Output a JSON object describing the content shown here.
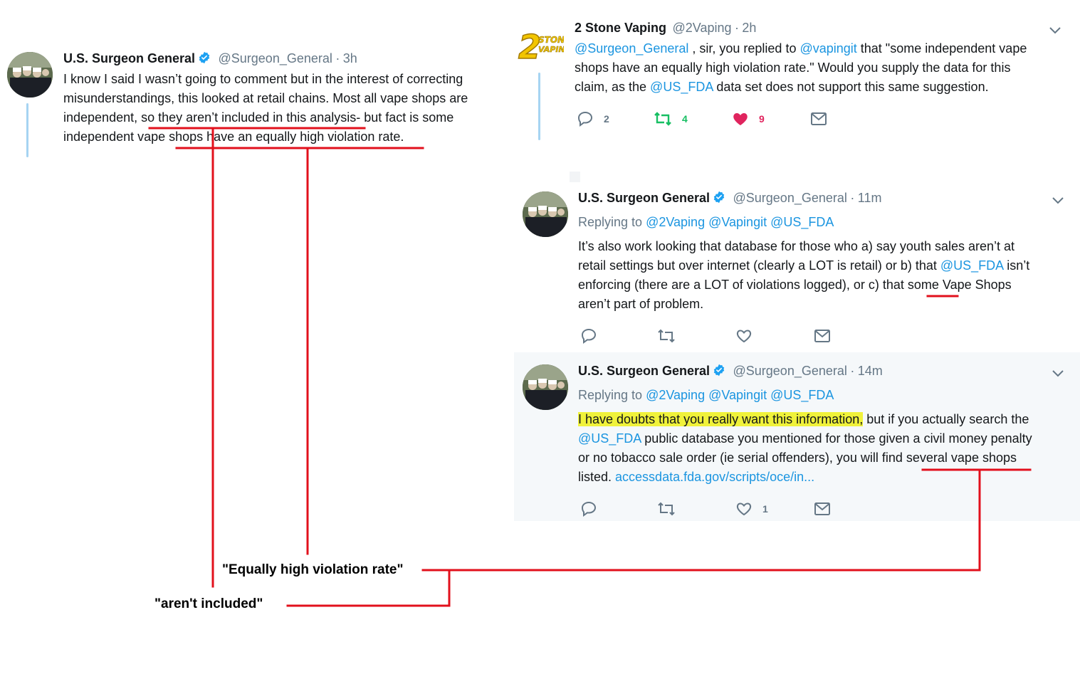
{
  "tweet_left": {
    "name": "U.S. Surgeon General",
    "handle": "@Surgeon_General",
    "sep": "·",
    "time": "3h",
    "line1": "I know I said I wasn’t going to comment but in the interest of correcting",
    "line2": "misunderstandings, this looked at retail chains.  Most all vape shops are",
    "line3": "independent, so they aren’t included in this analysis- but fact is some",
    "line4": "independent vape shops have an equally high violation rate."
  },
  "tweet_2stone": {
    "logo_text": "2",
    "logo_sub": "STONE VAPING",
    "name": "2 Stone Vaping",
    "handle": "@2Vaping",
    "sep": "·",
    "time": "2h",
    "mention1": "@Surgeon_General",
    "text1": " , sir, you replied to ",
    "mention2": "@vapingit",
    "text2": " that \"some independent vape",
    "line2": "shops have an equally high violation rate.\" Would you supply the data for this",
    "line3_a": "claim, as the ",
    "mention3": "@US_FDA",
    "line3_b": " data set does not support this same suggestion.",
    "reply_count": "2",
    "retweet_count": "4",
    "like_count": "9"
  },
  "tweet_sg2": {
    "name": "U.S. Surgeon General",
    "handle": "@Surgeon_General",
    "sep": "·",
    "time": "11m",
    "replying_label": "Replying to",
    "replying_1": "@2Vaping",
    "replying_2": "@Vapingit",
    "replying_3": "@US_FDA",
    "line1": "It’s also work looking that database for those who a) say youth sales aren’t at",
    "line2": "retail settings but over internet (clearly a LOT is retail) or b) that ",
    "line2_mention": "@US_FDA",
    "line2_end": " isn’t",
    "line3": "enforcing (there are a LOT of violations logged), or c) that some Vape Shops",
    "line4": "aren’t part of problem."
  },
  "tweet_sg3": {
    "name": "U.S. Surgeon General",
    "handle": "@Surgeon_General",
    "sep": "·",
    "time": "14m",
    "replying_label": "Replying to",
    "replying_1": "@2Vaping",
    "replying_2": "@Vapingit",
    "replying_3": "@US_FDA",
    "line1_hl": "I have doubts that you really want this information,",
    "line1_rest": " but if you actually search the",
    "line2_mention": "@US_FDA",
    "line2_rest": " public database you mentioned for those given a civil money penalty",
    "line3": "or no tobacco sale order (ie serial offenders), you will find several vape shops",
    "line4_a": "listed. ",
    "line4_link": "accessdata.fda.gov/scripts/oce/in...",
    "like_count": "1"
  },
  "annotations": {
    "label_equally": "\"Equally high violation rate\"",
    "label_included": "\"aren't included\""
  },
  "colors": {
    "annotation_red": "#e2101c",
    "link_blue": "#1b95e0",
    "retweet_green": "#17bf63",
    "like_red": "#e0245e",
    "gray": "#657786",
    "highlight": "#f0f23a",
    "focused_bg": "#f5f8fa"
  }
}
